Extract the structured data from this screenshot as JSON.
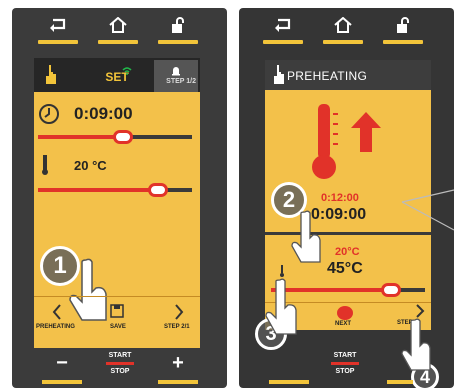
{
  "left_panel": {
    "header": {
      "title": "SET",
      "step": "STEP 1/2"
    },
    "time_value": "0:09:00",
    "temp_value": "20 °C",
    "time_slider_percent": 55,
    "temp_slider_percent": 78,
    "bottom_nav": {
      "prev": "PREHEATING",
      "save": "SAVE",
      "next": "STEP 2/1"
    },
    "footer": {
      "minus": "−",
      "start": "START",
      "stop": "STOP",
      "plus": "+"
    },
    "badge": "1"
  },
  "right_panel": {
    "header": {
      "title": "PREHEATING"
    },
    "time_target": "0:12:00",
    "time_value": "0:09:00",
    "temp_target": "20°C",
    "temp_value": "45°C",
    "temp_slider_percent": 78,
    "bottom_nav": {
      "next_label": "NEXT",
      "step_label": "STEP"
    },
    "footer": {
      "start": "START",
      "stop": "STOP"
    },
    "badges": [
      "2",
      "3",
      "4"
    ]
  },
  "colors": {
    "panel_bg": "#3b3b3b",
    "screen_bg": "#f3c14a",
    "accent_yellow": "#f2c43a",
    "accent_red": "#e13229"
  },
  "icons": [
    "back-icon",
    "home-icon",
    "lock-icon",
    "hand-icon",
    "timer-icon",
    "thermometer-icon",
    "arrow-up-icon",
    "save-icon",
    "chevron-left-icon",
    "chevron-right-icon",
    "wifi-icon",
    "bell-icon",
    "pointer-hand-icon"
  ]
}
